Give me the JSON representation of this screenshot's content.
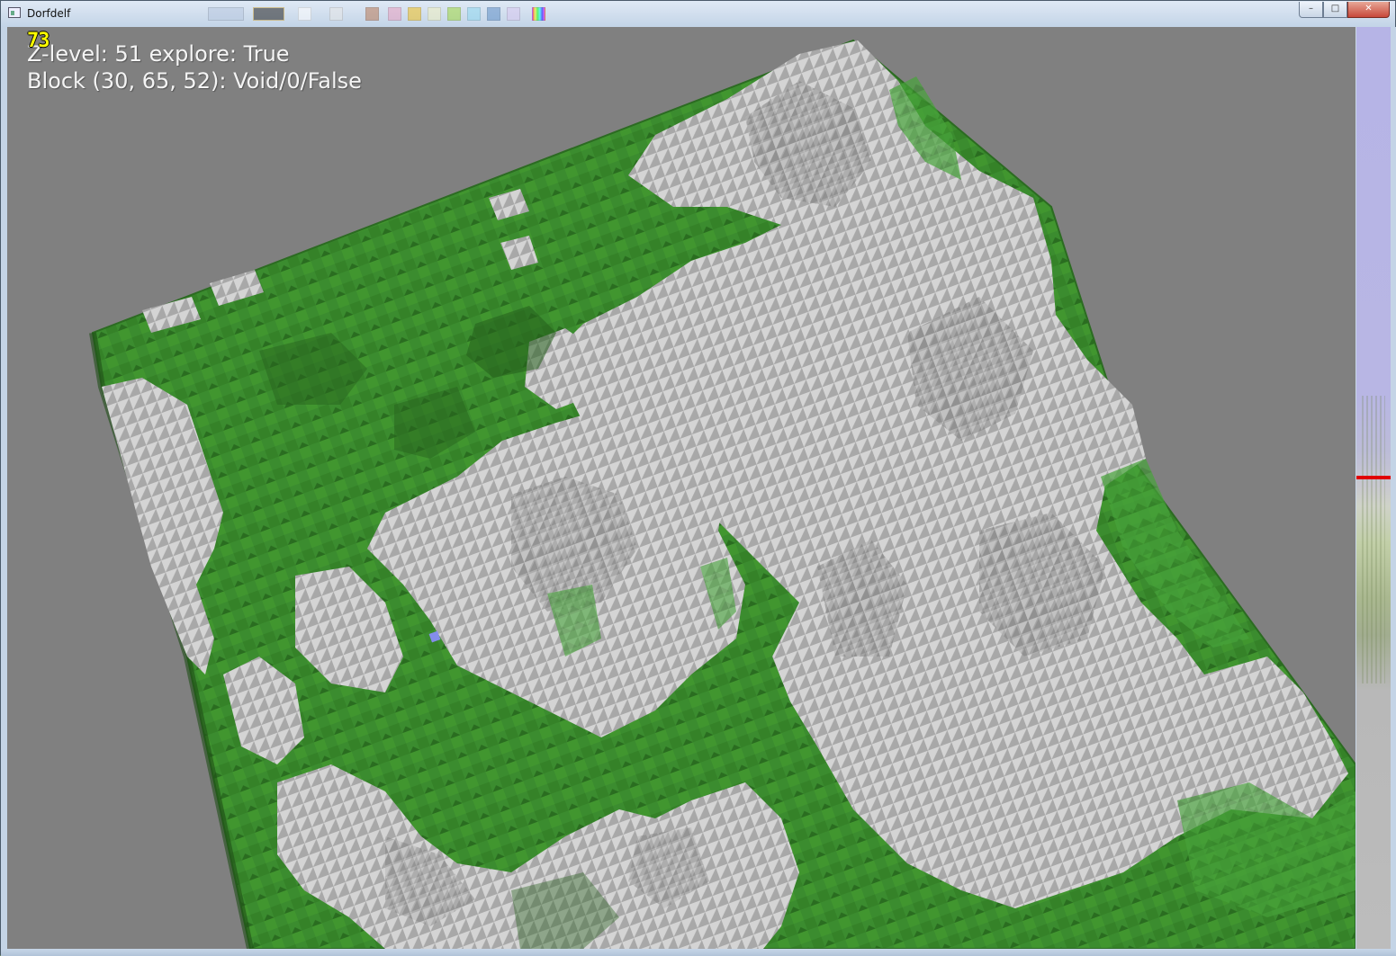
{
  "window": {
    "title": "Dorfdelf",
    "buttons": {
      "minimize": "–",
      "maximize": "□",
      "close": "✕"
    }
  },
  "hud": {
    "fps": "73",
    "zlevel_line": "Z-level: 51  explore: True",
    "block_line": "Block (30, 65, 52): Void/0/False"
  },
  "colors": {
    "background": "#808080",
    "grass": "#3a8a2e",
    "rock": "#c8c8c8",
    "depth_slider_top": "#b6b4e6",
    "depth_marker": "#e00000",
    "fps_text": "#ffff00",
    "cursor_marker": "#8d8dff"
  },
  "depth_slider": {
    "level_fraction": 0.487
  }
}
